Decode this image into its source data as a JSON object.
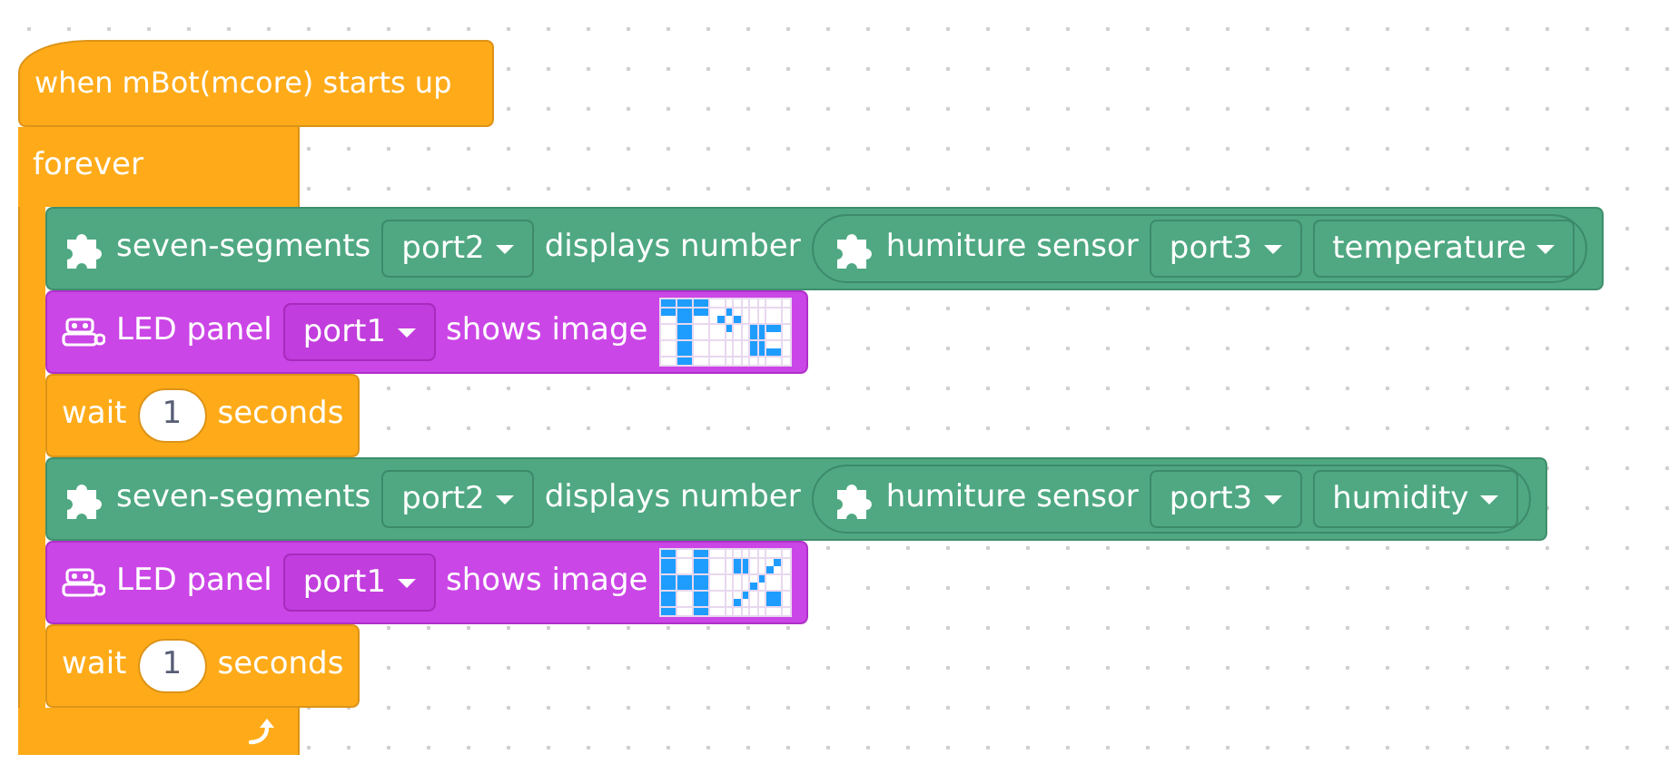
{
  "hat": {
    "label": "when mBot(mcore) starts up"
  },
  "loop": {
    "label": "forever"
  },
  "blocks": [
    {
      "kind": "display",
      "label": "seven-segments",
      "port": "port2",
      "action": "displays number",
      "reporter": {
        "label": "humiture sensor",
        "port": "port3",
        "option": "temperature"
      }
    },
    {
      "kind": "led",
      "label": "LED panel",
      "port": "port1",
      "action": "shows image"
    },
    {
      "kind": "wait",
      "label": "wait",
      "value": "1",
      "unit": "seconds"
    },
    {
      "kind": "display",
      "label": "seven-segments",
      "port": "port2",
      "action": "displays number",
      "reporter": {
        "label": "humiture sensor",
        "port": "port3",
        "option": "humidity"
      }
    },
    {
      "kind": "led",
      "label": "LED panel",
      "port": "port1",
      "action": "shows image"
    },
    {
      "kind": "wait",
      "label": "wait",
      "value": "1",
      "unit": "seconds"
    }
  ]
}
